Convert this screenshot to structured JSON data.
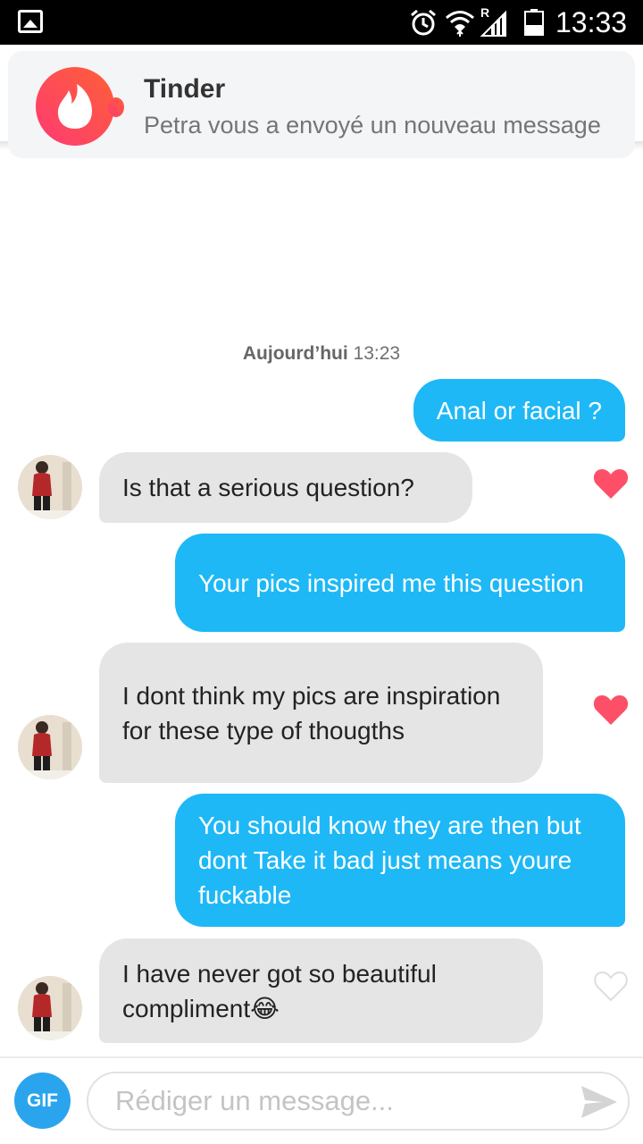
{
  "status_bar": {
    "time": "13:33",
    "icons": [
      "gallery-icon",
      "alarm-icon",
      "wifi-icon",
      "signal-roaming-icon",
      "battery-icon"
    ]
  },
  "notification": {
    "app": "Tinder",
    "text": "Petra vous a envoyé un nouveau message"
  },
  "chat": {
    "date_day": "Aujourd’hui",
    "date_time": "13:23",
    "messages": [
      {
        "from": "me",
        "text": "Anal or facial ?"
      },
      {
        "from": "match",
        "text": "Is that a serious question?",
        "liked": true
      },
      {
        "from": "me",
        "text": "Your pics inspired me this question"
      },
      {
        "from": "match",
        "text": "I dont think my pics are inspiration for these type of thougths",
        "liked": true
      },
      {
        "from": "me",
        "text": "You should know they are then but dont Take it bad just means youre fuckable"
      },
      {
        "from": "match",
        "text": "I have never got so beautiful compliment😂",
        "liked": false
      }
    ]
  },
  "composer": {
    "gif_label": "GIF",
    "placeholder": "Rédiger un message..."
  },
  "colors": {
    "sent_bubble": "#1eb8f6",
    "received_bubble": "#e5e5e5",
    "tinder_gradient_start": "#fd5068",
    "tinder_gradient_end": "#ff6036",
    "liked_heart": "#fd5068",
    "gif_button": "#2aa5ed"
  }
}
